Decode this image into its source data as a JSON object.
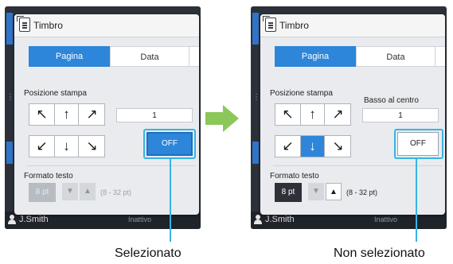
{
  "dialog": {
    "title": "Timbro",
    "tabs": [
      "Pagina",
      "Data"
    ],
    "position_label": "Posizione stampa",
    "arrows": {
      "top": [
        "↖",
        "↑",
        "↗"
      ],
      "bottom": [
        "↙",
        "↓",
        "↘"
      ]
    },
    "value": "1",
    "off_label": "OFF",
    "text_format_label": "Formato testo",
    "size_value": "8",
    "size_unit": "pt",
    "range": "(8 - 32 pt)",
    "stepper_down": "▼",
    "stepper_up": "▲"
  },
  "right": {
    "position_value_label": "Basso al centro",
    "selected_arrow": "bottom-center"
  },
  "footer": {
    "user": "J.Smith",
    "status": "Inattivo"
  },
  "captions": {
    "left": "Selezionato",
    "right": "Non selezionato"
  },
  "colors": {
    "accent": "#2d86d9",
    "highlight": "#37b4e6",
    "arrow": "#8cc75a"
  }
}
